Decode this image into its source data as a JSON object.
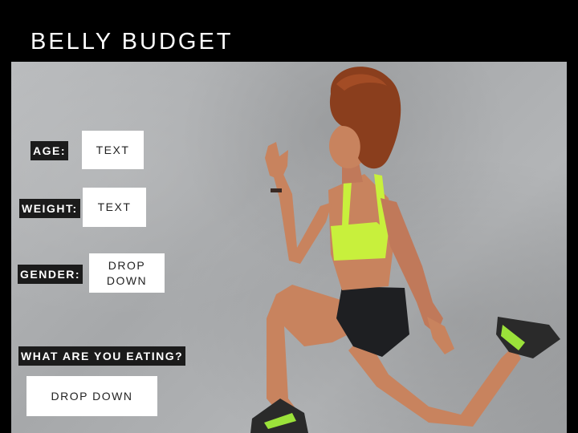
{
  "app": {
    "title": "BELLY BUDGET"
  },
  "form": {
    "age": {
      "label": "AGE:",
      "value": "TEXT"
    },
    "weight": {
      "label": "WEIGHT:",
      "value": "TEXT"
    },
    "gender": {
      "label": "GENDER:",
      "line1": "DROP",
      "line2": "DOWN"
    },
    "eating": {
      "label": "WHAT ARE YOU EATING?",
      "value": "DROP DOWN"
    }
  },
  "colors": {
    "background": "#000000",
    "concrete": "#a9abad",
    "label_bg": "#1b1b1b",
    "field_bg": "#ffffff",
    "accent_green": "#c8f03c"
  }
}
